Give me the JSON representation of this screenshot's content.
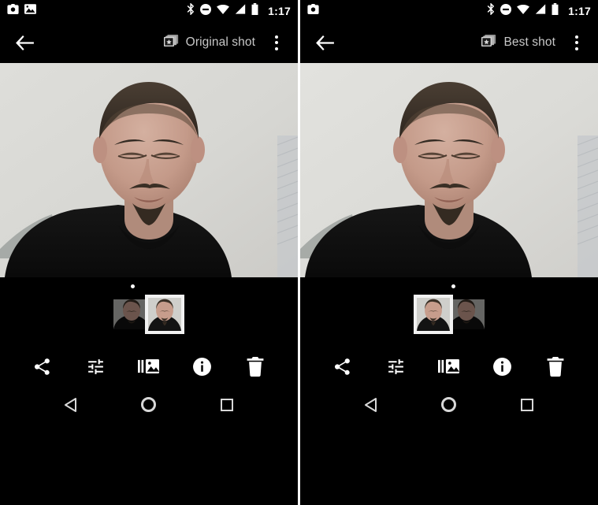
{
  "screens": [
    {
      "id": "left",
      "statusbar": {
        "left_icons": [
          "camera-icon",
          "image-icon"
        ],
        "right_icons": [
          "bluetooth-icon",
          "do-not-disturb-icon",
          "wifi-icon",
          "cell-signal-icon",
          "battery-icon"
        ],
        "time": "1:17"
      },
      "toolbar": {
        "back_label": "Back",
        "mode_icon": "burst-shot-icon",
        "mode_label": "Original shot",
        "overflow_label": "More options"
      },
      "photo": {
        "alt": "Portrait of a man with eyes closed wearing a black t-shirt against a light gray wall",
        "wall_color": "#d9d9d6",
        "shirt_color": "#121212",
        "skin_color": "#c7a392",
        "hair_color": "#3c3229"
      },
      "filmstrip": {
        "dot_indicator": true,
        "thumbs": [
          {
            "state": "unselected",
            "position": "left",
            "label": "Burst frame 1"
          },
          {
            "state": "selected",
            "position": "right",
            "label": "Burst frame 2"
          }
        ]
      },
      "actions": [
        {
          "icon": "share-icon",
          "label": "Share"
        },
        {
          "icon": "tune-icon",
          "label": "Edit"
        },
        {
          "icon": "burst-stack-icon",
          "label": "Burst"
        },
        {
          "icon": "info-icon",
          "label": "Details"
        },
        {
          "icon": "trash-icon",
          "label": "Delete"
        }
      ],
      "navbar": [
        {
          "icon": "back-triangle-icon",
          "label": "Back"
        },
        {
          "icon": "home-circle-icon",
          "label": "Home"
        },
        {
          "icon": "recents-square-icon",
          "label": "Recents"
        }
      ]
    },
    {
      "id": "right",
      "statusbar": {
        "left_icons": [
          "camera-icon"
        ],
        "right_icons": [
          "bluetooth-icon",
          "do-not-disturb-icon",
          "wifi-icon",
          "cell-signal-icon",
          "battery-icon"
        ],
        "time": "1:17"
      },
      "toolbar": {
        "back_label": "Back",
        "mode_icon": "burst-shot-icon",
        "mode_label": "Best shot",
        "overflow_label": "More options"
      },
      "photo": {
        "alt": "Portrait of a man with eyes closed wearing a black t-shirt against a light gray wall",
        "wall_color": "#dcdcd9",
        "shirt_color": "#121212",
        "skin_color": "#c7a392",
        "hair_color": "#3c3229"
      },
      "filmstrip": {
        "dot_indicator": true,
        "thumbs": [
          {
            "state": "selected",
            "position": "left",
            "label": "Burst frame 1"
          },
          {
            "state": "unselected",
            "position": "right",
            "label": "Burst frame 2"
          }
        ]
      },
      "actions": [
        {
          "icon": "share-icon",
          "label": "Share"
        },
        {
          "icon": "tune-icon",
          "label": "Edit"
        },
        {
          "icon": "burst-stack-icon",
          "label": "Burst"
        },
        {
          "icon": "info-icon",
          "label": "Details"
        },
        {
          "icon": "trash-icon",
          "label": "Delete"
        }
      ],
      "navbar": [
        {
          "icon": "back-triangle-icon",
          "label": "Back"
        },
        {
          "icon": "home-circle-icon",
          "label": "Home"
        },
        {
          "icon": "recents-square-icon",
          "label": "Recents"
        }
      ]
    }
  ],
  "colors": {
    "background": "#000000",
    "divider": "#ffffff",
    "icon": "#ffffff",
    "mode_label": "#c8c8c8",
    "nav_icon": "#d8d8d8",
    "selected_border": "#f2f2f2"
  }
}
